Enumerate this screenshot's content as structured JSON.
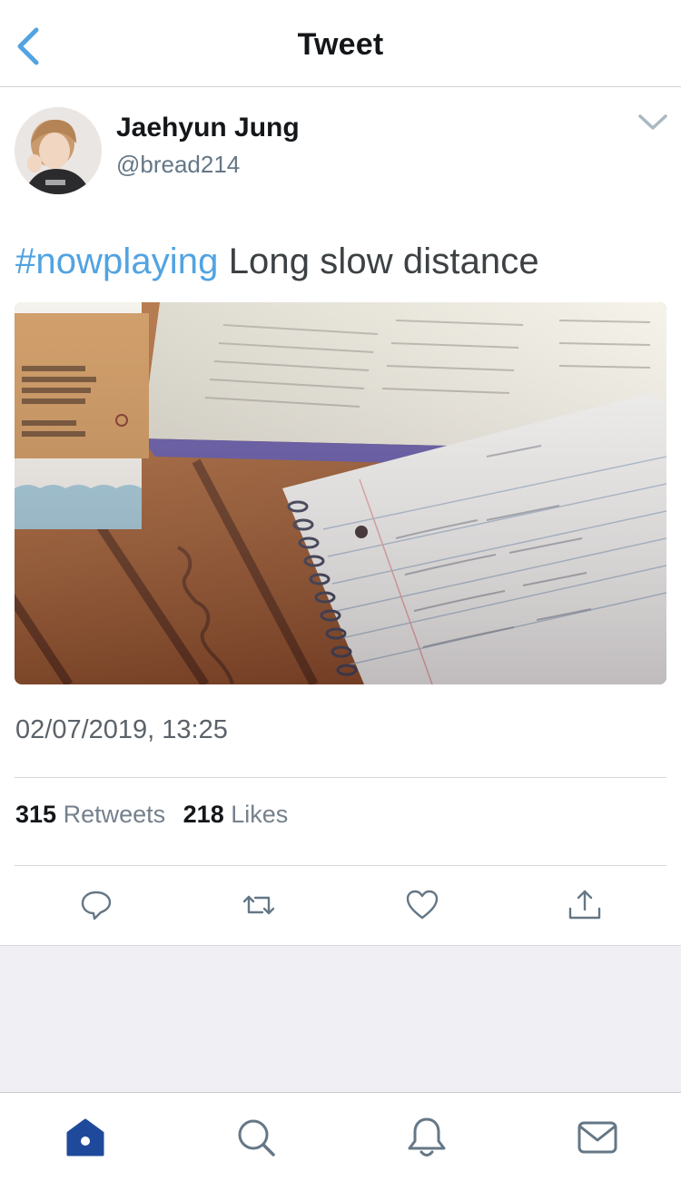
{
  "header": {
    "title": "Tweet",
    "back_icon": "chevron-left-icon"
  },
  "author": {
    "name": "Jaehyun Jung",
    "handle": "@bread214"
  },
  "tweet": {
    "hashtag": "#nowplaying",
    "text": " Long slow distance",
    "timestamp": "02/07/2019, 13:25"
  },
  "stats": {
    "retweets_count": "315",
    "retweets_label": "Retweets",
    "likes_count": "218",
    "likes_label": "Likes"
  },
  "actions": [
    "reply-icon",
    "retweet-icon",
    "like-icon",
    "share-icon"
  ],
  "tabs": [
    "home-icon",
    "search-icon",
    "notifications-icon",
    "messages-icon"
  ],
  "colors": {
    "accent": "#52a3e1",
    "tab_active": "#1f4a9b",
    "icon_gray": "#657786",
    "gray_area": "#efeff4"
  }
}
